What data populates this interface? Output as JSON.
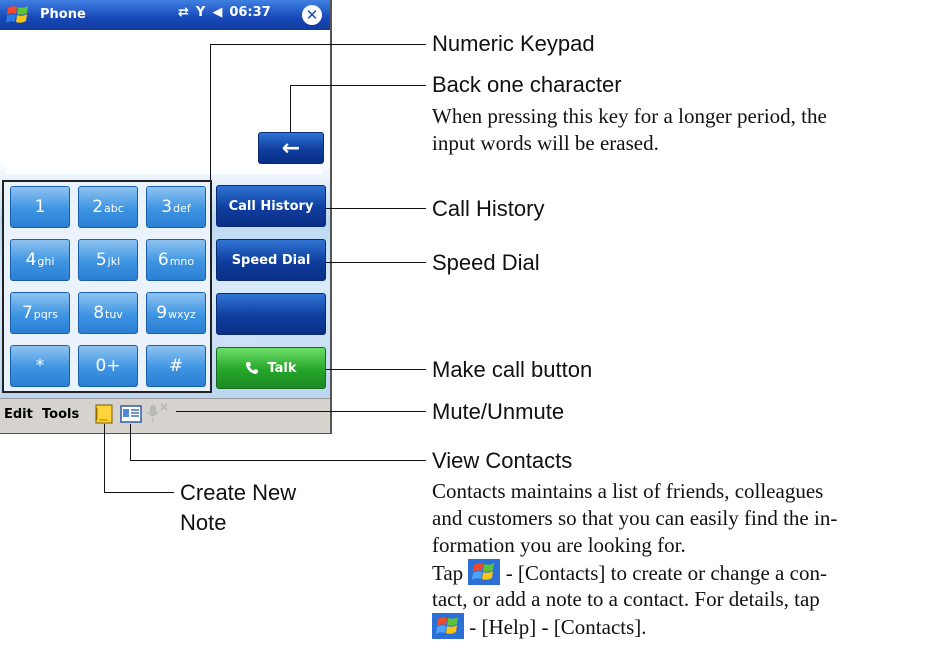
{
  "phone": {
    "title": "Phone",
    "clock": "06:37",
    "status_icons": [
      "connectivity-icon",
      "signal-icon",
      "volume-icon"
    ],
    "back_key_label": "←",
    "keys": [
      {
        "digit": "1",
        "letters": ""
      },
      {
        "digit": "2",
        "letters": "abc"
      },
      {
        "digit": "3",
        "letters": "def"
      },
      {
        "digit": "4",
        "letters": "ghi"
      },
      {
        "digit": "5",
        "letters": "jkl"
      },
      {
        "digit": "6",
        "letters": "mno"
      },
      {
        "digit": "7",
        "letters": "pqrs"
      },
      {
        "digit": "8",
        "letters": "tuv"
      },
      {
        "digit": "9",
        "letters": "wxyz"
      },
      {
        "digit": "*",
        "letters": ""
      },
      {
        "digit": "0+",
        "letters": ""
      },
      {
        "digit": "#",
        "letters": ""
      }
    ],
    "call_history_label": "Call History",
    "speed_dial_label": "Speed Dial",
    "talk_label": "Talk",
    "menu_edit": "Edit",
    "menu_tools": "Tools"
  },
  "callouts": {
    "numeric_keypad": "Numeric Keypad",
    "back_title": "Back one character",
    "back_desc_1": "When pressing this key for a longer period, the",
    "back_desc_2": "input words will be erased.",
    "call_history": "Call History",
    "speed_dial": "Speed Dial",
    "make_call": "Make call button",
    "mute": "Mute/Unmute",
    "view_contacts": "View Contacts",
    "contacts_desc_1": "Contacts maintains a list of friends, colleagues",
    "contacts_desc_2": "and customers so that you can easily find the in-",
    "contacts_desc_3": "formation you are looking for.",
    "contacts_desc_4a": "Tap",
    "contacts_desc_4b": "- [Contacts] to create or change a con-",
    "contacts_desc_5": "tact, or add a note to a contact. For details, tap",
    "contacts_desc_6": "- [Help] - [Contacts].",
    "create_note_1": "Create New",
    "create_note_2": "Note"
  },
  "colors": {
    "title_bar": "#1748b8",
    "key_blue": "#3e94e2",
    "dark_button": "#0f3d9e",
    "talk_green": "#25a52a",
    "menu_bar": "#d6d3ce"
  }
}
